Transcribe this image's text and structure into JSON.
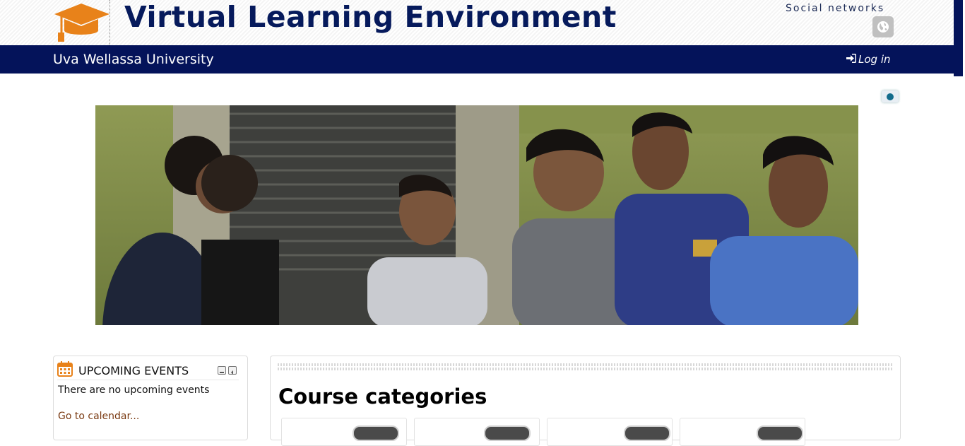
{
  "header": {
    "site_title": "Virtual Learning Environment",
    "social_label": "Social networks",
    "social_icon": "globe-icon",
    "logo_icon": "graduation-cap-icon"
  },
  "navbar": {
    "university": "Uva Wellassa University",
    "login_label": "Log in",
    "login_icon": "sign-in-icon"
  },
  "banner": {
    "alt": "Students on campus steps"
  },
  "upcoming_events": {
    "title": "UPCOMING EVENTS",
    "icon": "calendar-icon",
    "empty_text": "There are no upcoming events",
    "calendar_link": "Go to calendar..."
  },
  "main": {
    "heading": "Course categories"
  },
  "colors": {
    "brand_navy": "#04135a",
    "logo_orange": "#e8821a",
    "link_brown": "#7a3a12"
  }
}
